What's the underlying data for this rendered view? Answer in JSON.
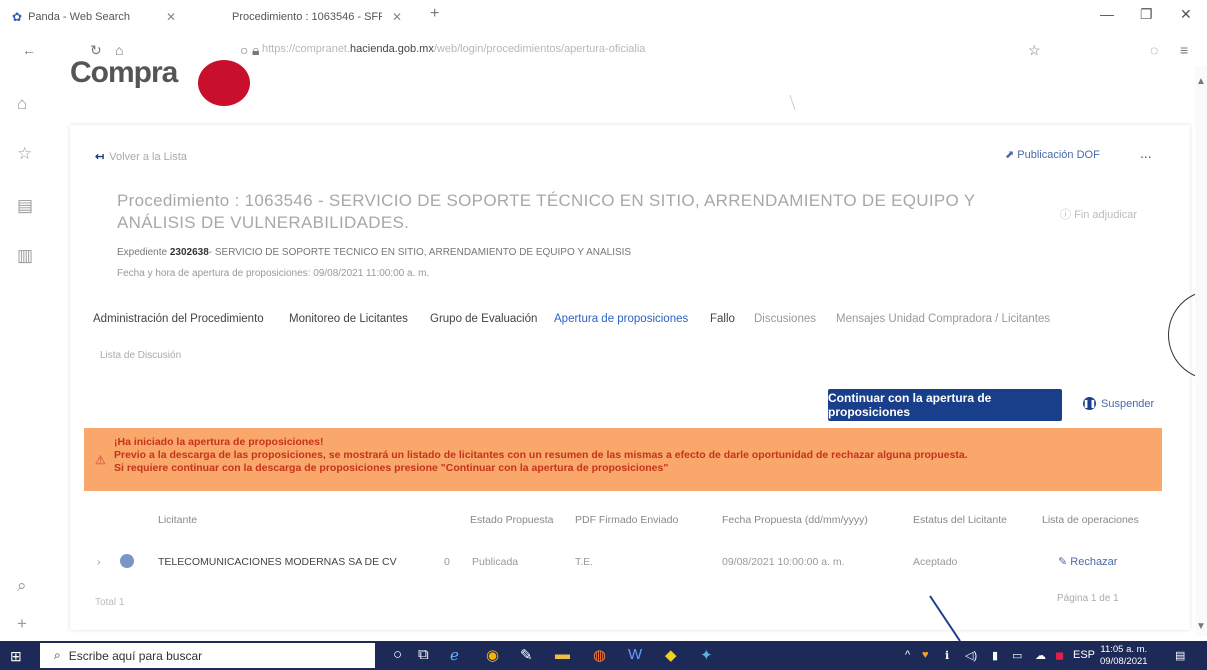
{
  "browser": {
    "tabs": [
      {
        "title": "Panda - Web Search"
      },
      {
        "title": "Procedimiento : 1063546 - SFF..."
      }
    ],
    "url_prefix": "https://compranet.",
    "url_domain": "hacienda.gob.mx",
    "url_suffix": "/web/login/procedimientos/apertura-oficialia"
  },
  "page": {
    "logo_text": "Compra",
    "back_link": "Volver a la Lista",
    "dof_link": "Publicación DOF",
    "more": "...",
    "title": "Procedimiento : 1063546 - SERVICIO DE SOPORTE TÉCNICO EN SITIO, ARRENDAMIENTO DE EQUIPO Y ANÁLISIS DE VULNERABILIDADES.",
    "fin_adjudicar": "Fin adjudicar",
    "expediente_label": "Expediente",
    "expediente_num": "2302638",
    "expediente_desc": "- SERVICIO DE SOPORTE TECNICO EN SITIO, ARRENDAMIENTO DE EQUIPO Y ANALISIS",
    "fecha_apertura": "Fecha y hora de apertura de proposiciones: 09/08/2021 11:00:00 a. m.",
    "tabs": [
      "Administración del Procedimiento",
      "Monitoreo de Licitantes",
      "Grupo de Evaluación",
      "Apertura de proposiciones",
      "Fallo",
      "Discusiones",
      "Mensajes Unidad Compradora / Licitantes"
    ],
    "subtab": "Lista de Discusión",
    "continuar_button": "Continuar con la apertura de proposiciones",
    "suspender": "Suspender",
    "alert": {
      "line1": "¡Ha iniciado la apertura de proposiciones!",
      "line2": "Previo a la descarga de las proposiciones, se mostrará un listado de licitantes con un resumen de las mismas a efecto de darle oportunidad de rechazar alguna propuesta.",
      "line3": "Si requiere continuar con la descarga de proposiciones presione \"Continuar con la apertura de proposiciones\""
    },
    "table": {
      "headers": [
        "Licitante",
        "Estado Propuesta",
        "PDF Firmado Enviado",
        "Fecha Propuesta (dd/mm/yyyy)",
        "Estatus del Licitante",
        "Lista de operaciones"
      ],
      "rows": [
        {
          "licitante": "TELECOMUNICACIONES MODERNAS SA DE CV",
          "count": "0",
          "estado": "Publicada",
          "pdf": "T.E.",
          "fecha": "09/08/2021 10:00:00 a. m.",
          "estatus": "Aceptado",
          "accion": "Rechazar"
        }
      ],
      "total": "Total 1",
      "pagina": "Página 1 de 1"
    }
  },
  "taskbar": {
    "search_placeholder": "Escribe aquí para buscar",
    "lang": "ESP",
    "time": "11:05 a. m.",
    "date": "09/08/2021"
  }
}
